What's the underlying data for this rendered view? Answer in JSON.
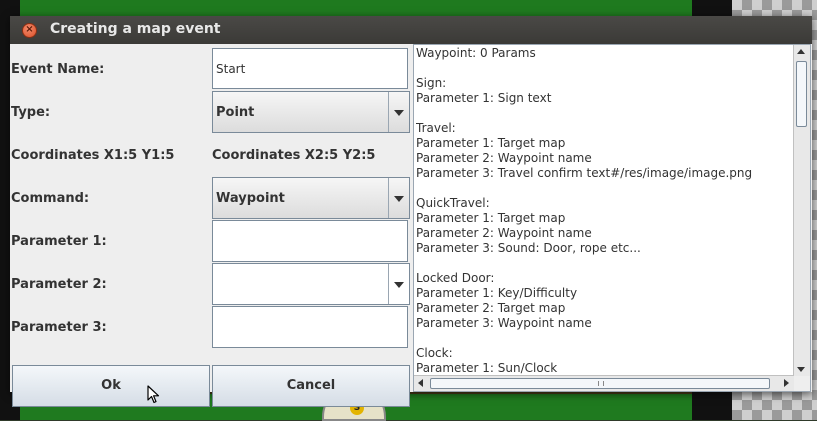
{
  "window": {
    "title": "Creating a map event",
    "close_glyph": "×"
  },
  "form": {
    "event_name_label": "Event Name:",
    "event_name_value": "Start",
    "type_label": "Type:",
    "type_value": "Point",
    "coord1_label": "Coordinates X1:5 Y1:5",
    "coord2_label": "Coordinates X2:5 Y2:5",
    "command_label": "Command:",
    "command_value": "Waypoint",
    "param1_label": "Parameter 1:",
    "param1_value": "",
    "param2_label": "Parameter 2:",
    "param2_value": "",
    "param3_label": "Parameter 3:",
    "param3_value": ""
  },
  "buttons": {
    "ok": "Ok",
    "cancel": "Cancel"
  },
  "info": {
    "text": "Waypoint: 0 Params\n\nSign:\nParameter 1: Sign text\n\nTravel:\nParameter 1: Target map\nParameter 2: Waypoint name\nParameter 3: Travel confirm text#/res/image/image.png\n\nQuickTravel:\nParameter 1: Target map\nParameter 2: Waypoint name\nParameter 3: Sound: Door, rope etc...\n\nLocked Door:\nParameter 1: Key/Difficulty\nParameter 2: Target map\nParameter 3: Waypoint name\n\nClock:\nParameter 1: Sun/Clock"
  },
  "background": {
    "compass_letter": "S"
  },
  "colors": {
    "titlebar": "#3b3a37",
    "close": "#e35a2f",
    "grass": "#1f7a1f"
  }
}
